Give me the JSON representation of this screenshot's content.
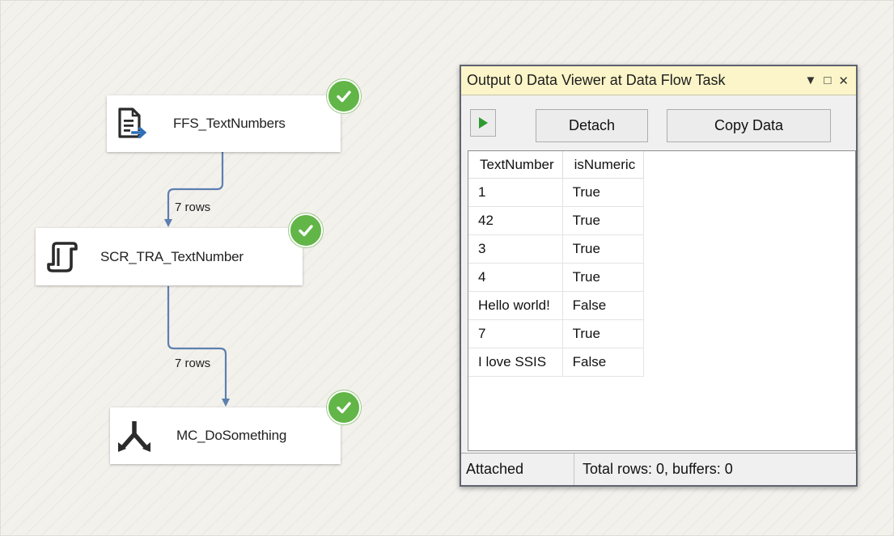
{
  "canvas": {
    "flows": [
      {
        "label": "7 rows"
      },
      {
        "label": "7 rows"
      }
    ],
    "components": [
      {
        "name": "FFS_TextNumbers",
        "icon": "flat-file-source-icon",
        "status": "success"
      },
      {
        "name": "SCR_TRA_TextNumber",
        "icon": "script-component-icon",
        "status": "success"
      },
      {
        "name": "MC_DoSomething",
        "icon": "multicast-icon",
        "status": "success"
      }
    ]
  },
  "viewer": {
    "title": "Output 0 Data Viewer at Data Flow Task",
    "title_controls": [
      "▼",
      "□",
      "✕"
    ],
    "toolbar": {
      "play_icon": "play-icon",
      "detach_label": "Detach",
      "copy_label": "Copy Data"
    },
    "grid": {
      "columns": [
        "TextNumber",
        "isNumeric"
      ],
      "rows": [
        [
          "1",
          "True"
        ],
        [
          "42",
          "True"
        ],
        [
          "3",
          "True"
        ],
        [
          "4",
          "True"
        ],
        [
          "Hello world!",
          "False"
        ],
        [
          "7",
          "True"
        ],
        [
          "I love SSIS",
          "False"
        ]
      ]
    },
    "status": {
      "left": "Attached",
      "right": "Total rows: 0, buffers: 0"
    }
  },
  "colors": {
    "flow_line": "#5d7fb0",
    "check_green": "#62b547",
    "titlebar": "#fbf5c9"
  }
}
